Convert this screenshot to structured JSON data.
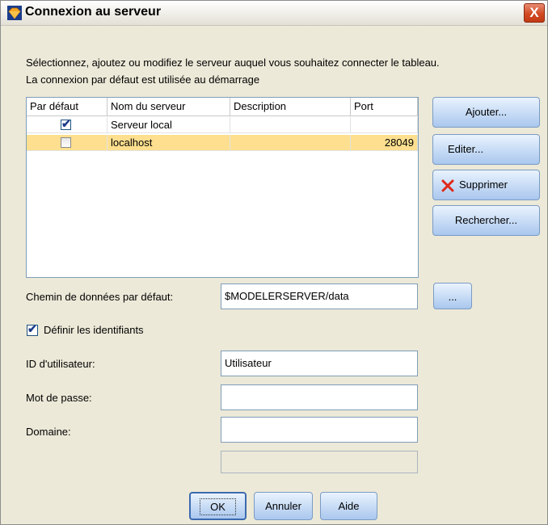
{
  "dialog": {
    "title": "Connexion au serveur",
    "close_label": "X",
    "description_line1": "Sélectionnez, ajoutez ou modifiez le serveur auquel vous souhaitez connecter le tableau.",
    "description_line2": "La connexion par défaut est utilisée au démarrage"
  },
  "table": {
    "headers": [
      "Par défaut",
      "Nom du serveur",
      "Description",
      "Port"
    ],
    "rows": [
      {
        "default_checked": true,
        "name": "Serveur local",
        "description": "",
        "port": ""
      },
      {
        "default_checked": false,
        "name": "localhost",
        "description": "",
        "port": "28049",
        "selected": true
      }
    ]
  },
  "side_buttons": {
    "add": "Ajouter...",
    "edit": "Editer...",
    "delete": "Supprimer",
    "search": "Rechercher..."
  },
  "data_path": {
    "label": "Chemin de données par défaut:",
    "value": "$MODELERSERVER/data",
    "browse": "..."
  },
  "credentials": {
    "checkbox_label": "Définir les identifiants",
    "checked": true,
    "user_label": "ID d'utilisateur:",
    "user_value": "Utilisateur",
    "password_label": "Mot de passe:",
    "password_value": "",
    "domain_label": "Domaine:",
    "domain_value": "",
    "extra_value": ""
  },
  "footer": {
    "ok": "OK",
    "cancel": "Annuler",
    "help": "Aide"
  }
}
